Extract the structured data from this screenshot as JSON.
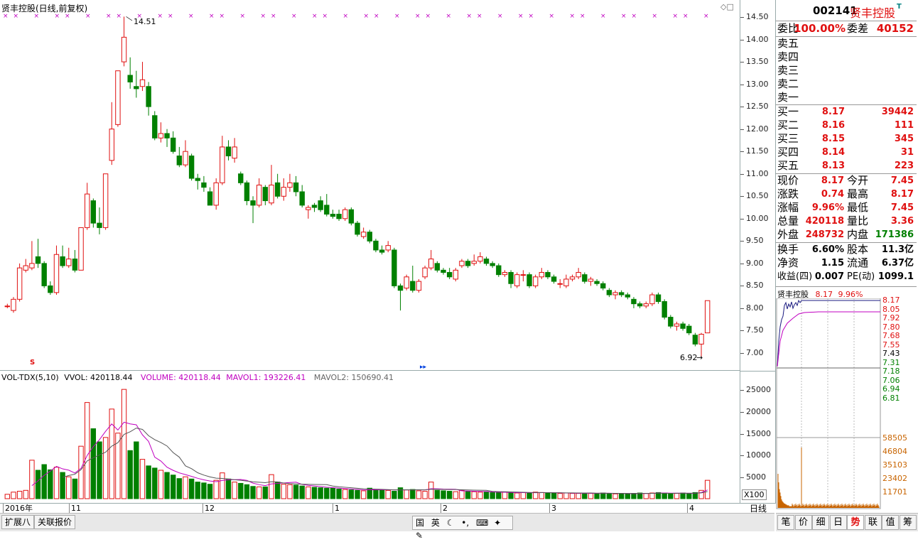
{
  "chart_title": "贤丰控股(日线,前复权)",
  "main_high_label": "14.51",
  "main_low_label": "6.92",
  "vol_header": {
    "name": "VOL-TDX(5,10)",
    "vvol": "VVOL: 420118.44",
    "volume": "VOLUME: 420118.44",
    "mavol1": "MAVOL1: 193226.41",
    "mavol2": "MAVOL2: 150690.41"
  },
  "price_ticks": [
    "14.50",
    "14.00",
    "13.50",
    "13.00",
    "12.50",
    "12.00",
    "11.50",
    "11.00",
    "10.50",
    "10.00",
    "9.50",
    "9.00",
    "8.50",
    "8.00",
    "7.50",
    "7.00"
  ],
  "vol_ticks": [
    "25000",
    "20000",
    "15000",
    "10000",
    "5000"
  ],
  "vol_unit": "X100",
  "date_ticks": [
    "2016年",
    "11",
    "12",
    "1",
    "2",
    "3",
    "4"
  ],
  "period_label": "日线",
  "bottom_tabs": [
    "扩展八",
    "关联报价"
  ],
  "ime_icons": [
    "国",
    "英"
  ],
  "quote": {
    "code": "002141",
    "name": "贤丰控股",
    "weibi_label": "委比",
    "weibi": "100.00%",
    "weicha_label": "委差",
    "weicha": "40152",
    "sell": [
      {
        "label": "卖五",
        "price": "",
        "vol": ""
      },
      {
        "label": "卖四",
        "price": "",
        "vol": ""
      },
      {
        "label": "卖三",
        "price": "",
        "vol": ""
      },
      {
        "label": "卖二",
        "price": "",
        "vol": ""
      },
      {
        "label": "卖一",
        "price": "",
        "vol": ""
      }
    ],
    "buy": [
      {
        "label": "买一",
        "price": "8.17",
        "vol": "39442"
      },
      {
        "label": "买二",
        "price": "8.16",
        "vol": "111"
      },
      {
        "label": "买三",
        "price": "8.15",
        "vol": "345"
      },
      {
        "label": "买四",
        "price": "8.14",
        "vol": "31"
      },
      {
        "label": "买五",
        "price": "8.13",
        "vol": "223"
      }
    ],
    "stats": [
      {
        "l1": "现价",
        "v1": "8.17",
        "c1": "red",
        "l2": "今开",
        "v2": "7.45",
        "c2": "red"
      },
      {
        "l1": "涨跌",
        "v1": "0.74",
        "c1": "red",
        "l2": "最高",
        "v2": "8.17",
        "c2": "red"
      },
      {
        "l1": "涨幅",
        "v1": "9.96%",
        "c1": "red",
        "l2": "最低",
        "v2": "7.45",
        "c2": "red"
      },
      {
        "l1": "总量",
        "v1": "420118",
        "c1": "red",
        "l2": "量比",
        "v2": "3.36",
        "c2": "red"
      },
      {
        "l1": "外盘",
        "v1": "248732",
        "c1": "red",
        "l2": "内盘",
        "v2": "171386",
        "c2": "green"
      }
    ],
    "fund": [
      {
        "l1": "换手",
        "v1": "6.60%",
        "l2": "股本",
        "v2": "11.3亿"
      },
      {
        "l1": "净资",
        "v1": "1.15",
        "l2": "流通",
        "v2": "6.37亿"
      },
      {
        "l1": "收益(四)",
        "v1": "0.007",
        "l2": "PE(动)",
        "v2": "1099.1"
      }
    ]
  },
  "mini": {
    "title": "贤丰控股",
    "price": "8.17",
    "pct": "9.96%",
    "price_ticks": [
      "8.17",
      "8.05",
      "7.92",
      "7.80",
      "7.68",
      "7.55",
      "7.43",
      "7.31",
      "7.18",
      "7.06",
      "6.94",
      "6.81"
    ],
    "vol_ticks": [
      "58505",
      "46804",
      "35103",
      "23402",
      "11701"
    ]
  },
  "right_tabs": [
    "笔",
    "价",
    "细",
    "日",
    "势",
    "联",
    "值",
    "筹"
  ],
  "right_tab_active": "势",
  "colors": {
    "up": "#e01010",
    "down": "#008000",
    "ma1": "#c000c0",
    "ma2": "#555555"
  },
  "chart_data": {
    "type": "candlestick",
    "ylim": [
      6.6,
      14.7
    ],
    "candles": [
      [
        8.05,
        8.05,
        8.1,
        8.0
      ],
      [
        7.95,
        8.2,
        8.25,
        7.9
      ],
      [
        8.2,
        8.9,
        9.0,
        8.15
      ],
      [
        8.85,
        8.95,
        9.1,
        8.8
      ],
      [
        8.9,
        9.0,
        9.5,
        8.85
      ],
      [
        9.15,
        9.0,
        9.55,
        8.9
      ],
      [
        9.0,
        8.5,
        9.05,
        8.45
      ],
      [
        8.5,
        8.35,
        8.6,
        8.3
      ],
      [
        8.35,
        9.2,
        9.4,
        8.3
      ],
      [
        9.15,
        8.95,
        9.4,
        8.9
      ],
      [
        8.95,
        9.1,
        9.35,
        8.9
      ],
      [
        9.1,
        8.85,
        9.3,
        8.8
      ],
      [
        8.85,
        9.8,
        9.8,
        8.85
      ],
      [
        9.8,
        10.55,
        10.8,
        9.75
      ],
      [
        10.4,
        9.9,
        10.45,
        9.8
      ],
      [
        9.9,
        9.8,
        10.25,
        9.65
      ],
      [
        9.8,
        11.0,
        11.0,
        9.75
      ],
      [
        11.3,
        12.0,
        12.6,
        11.2
      ],
      [
        12.1,
        13.3,
        13.3,
        12.05
      ],
      [
        13.5,
        14.05,
        14.51,
        13.4
      ],
      [
        13.2,
        13.05,
        13.6,
        12.9
      ],
      [
        12.95,
        12.9,
        13.3,
        12.7
      ],
      [
        12.95,
        13.1,
        13.5,
        12.85
      ],
      [
        12.95,
        12.5,
        13.05,
        12.3
      ],
      [
        12.3,
        11.8,
        12.4,
        11.75
      ],
      [
        11.8,
        11.9,
        12.15,
        11.7
      ],
      [
        11.9,
        11.8,
        12.0,
        11.6
      ],
      [
        11.8,
        11.5,
        11.95,
        11.45
      ],
      [
        11.4,
        11.2,
        11.6,
        11.15
      ],
      [
        11.2,
        11.5,
        11.75,
        11.15
      ],
      [
        11.4,
        10.9,
        11.45,
        10.85
      ],
      [
        10.9,
        10.85,
        11.0,
        10.65
      ],
      [
        10.8,
        10.7,
        10.95,
        10.6
      ],
      [
        10.6,
        10.3,
        10.7,
        10.3
      ],
      [
        10.3,
        10.8,
        10.9,
        10.2
      ],
      [
        10.8,
        11.6,
        11.85,
        10.75
      ],
      [
        11.6,
        11.4,
        11.75,
        11.3
      ],
      [
        11.35,
        11.6,
        11.8,
        11.25
      ],
      [
        11.0,
        10.8,
        11.05,
        10.75
      ],
      [
        10.8,
        10.4,
        10.85,
        10.3
      ],
      [
        10.4,
        10.3,
        10.5,
        9.9
      ],
      [
        10.3,
        10.75,
        10.9,
        10.25
      ],
      [
        10.7,
        10.4,
        10.75,
        10.3
      ],
      [
        10.35,
        10.75,
        11.2,
        10.3
      ],
      [
        10.8,
        10.5,
        11.0,
        10.45
      ],
      [
        10.5,
        10.7,
        10.9,
        10.4
      ],
      [
        10.7,
        10.8,
        11.0,
        10.6
      ],
      [
        10.8,
        10.6,
        10.95,
        10.5
      ],
      [
        10.6,
        10.3,
        10.75,
        10.25
      ],
      [
        10.2,
        10.25,
        10.3,
        10.0
      ],
      [
        10.3,
        10.25,
        10.35,
        10.15
      ],
      [
        10.4,
        10.2,
        10.5,
        10.15
      ],
      [
        10.3,
        10.1,
        10.55,
        10.05
      ],
      [
        10.1,
        10.05,
        10.2,
        10.0
      ],
      [
        10.1,
        10.0,
        10.2,
        9.95
      ],
      [
        10.0,
        10.2,
        10.25,
        9.95
      ],
      [
        10.2,
        9.9,
        10.25,
        9.85
      ],
      [
        9.9,
        9.65,
        9.95,
        9.6
      ],
      [
        9.6,
        9.7,
        9.8,
        9.55
      ],
      [
        9.7,
        9.5,
        9.75,
        9.45
      ],
      [
        9.5,
        9.3,
        9.55,
        9.25
      ],
      [
        9.3,
        9.25,
        9.4,
        9.2
      ],
      [
        9.3,
        9.4,
        9.5,
        9.25
      ],
      [
        9.3,
        8.5,
        9.35,
        8.45
      ],
      [
        8.5,
        8.4,
        8.55,
        7.95
      ],
      [
        8.45,
        8.7,
        8.75,
        8.4
      ],
      [
        8.6,
        8.4,
        8.95,
        8.35
      ],
      [
        8.4,
        8.6,
        8.65,
        8.35
      ],
      [
        8.7,
        8.9,
        8.95,
        8.65
      ],
      [
        8.9,
        9.1,
        9.3,
        8.85
      ],
      [
        9.0,
        8.85,
        9.05,
        8.8
      ],
      [
        8.85,
        8.8,
        8.9,
        8.75
      ],
      [
        8.8,
        8.7,
        8.9,
        8.65
      ],
      [
        8.65,
        8.85,
        8.9,
        8.6
      ],
      [
        8.95,
        9.05,
        9.1,
        8.9
      ],
      [
        9.05,
        8.95,
        9.1,
        8.9
      ],
      [
        9.0,
        9.05,
        9.2,
        8.95
      ],
      [
        9.05,
        9.15,
        9.25,
        9.0
      ],
      [
        9.1,
        9.0,
        9.15,
        8.95
      ],
      [
        9.0,
        8.95,
        9.05,
        8.9
      ],
      [
        8.95,
        8.75,
        9.0,
        8.7
      ],
      [
        8.75,
        8.8,
        8.85,
        8.7
      ],
      [
        8.8,
        8.55,
        8.85,
        8.45
      ],
      [
        8.5,
        8.75,
        8.8,
        8.45
      ],
      [
        8.75,
        8.75,
        8.85,
        8.6
      ],
      [
        8.75,
        8.5,
        8.8,
        8.45
      ],
      [
        8.5,
        8.7,
        8.75,
        8.45
      ],
      [
        8.7,
        8.8,
        8.9,
        8.65
      ],
      [
        8.8,
        8.7,
        8.85,
        8.65
      ],
      [
        8.7,
        8.6,
        8.75,
        8.55
      ],
      [
        8.55,
        8.55,
        8.65,
        8.45
      ],
      [
        8.5,
        8.65,
        8.75,
        8.45
      ],
      [
        8.65,
        8.7,
        8.75,
        8.6
      ],
      [
        8.7,
        8.8,
        8.9,
        8.65
      ],
      [
        8.75,
        8.6,
        8.8,
        8.55
      ],
      [
        8.6,
        8.65,
        8.7,
        8.5
      ],
      [
        8.6,
        8.55,
        8.65,
        8.5
      ],
      [
        8.55,
        8.45,
        8.6,
        8.4
      ],
      [
        8.4,
        8.3,
        8.45,
        8.25
      ],
      [
        8.3,
        8.35,
        8.4,
        8.2
      ],
      [
        8.35,
        8.3,
        8.4,
        8.25
      ],
      [
        8.3,
        8.25,
        8.35,
        8.2
      ],
      [
        8.2,
        8.1,
        8.25,
        8.0
      ],
      [
        8.1,
        8.05,
        8.15,
        8.0
      ],
      [
        8.05,
        8.1,
        8.15,
        8.0
      ],
      [
        8.1,
        8.3,
        8.35,
        8.05
      ],
      [
        8.3,
        8.15,
        8.35,
        8.1
      ],
      [
        8.15,
        7.8,
        8.2,
        7.75
      ],
      [
        7.8,
        7.6,
        7.85,
        7.55
      ],
      [
        7.6,
        7.65,
        7.7,
        7.5
      ],
      [
        7.65,
        7.55,
        7.7,
        7.5
      ],
      [
        7.6,
        7.45,
        7.65,
        7.4
      ],
      [
        7.4,
        7.2,
        7.45,
        7.15
      ],
      [
        7.2,
        7.42,
        7.45,
        6.92
      ],
      [
        7.45,
        8.17,
        8.17,
        7.45
      ]
    ],
    "volumes": [
      1000,
      1500,
      1700,
      1900,
      8800,
      6500,
      7800,
      6600,
      7200,
      6000,
      5000,
      4500,
      12000,
      22000,
      16000,
      13000,
      14000,
      20500,
      15000,
      25000,
      11000,
      13000,
      9000,
      7500,
      7000,
      6500,
      6000,
      5400,
      4600,
      5000,
      4500,
      3800,
      3600,
      3300,
      4200,
      5900,
      4500,
      3800,
      3500,
      3200,
      2800,
      2700,
      2700,
      5500,
      3800,
      3300,
      3200,
      3100,
      2900,
      2700,
      2600,
      2500,
      2400,
      2400,
      2200,
      2100,
      2000,
      1900,
      1800,
      2400,
      2100,
      2000,
      1900,
      1700,
      2500,
      2000,
      2100,
      1800,
      1700,
      3800,
      1900,
      1800,
      1700,
      1600,
      1900,
      1700,
      1600,
      1500,
      1500,
      1400,
      1400,
      1500,
      1300,
      1300,
      1400,
      1300,
      1500,
      1400,
      1300,
      1300,
      1200,
      1300,
      1200,
      1200,
      1300,
      1200,
      1200,
      1300,
      1200,
      1100,
      1200,
      1100,
      1200,
      1300,
      1200,
      1300,
      1400,
      1300,
      1100,
      1200,
      1300,
      1200,
      1400,
      1900,
      4200
    ],
    "vol_ylim": [
      0,
      27000
    ]
  }
}
